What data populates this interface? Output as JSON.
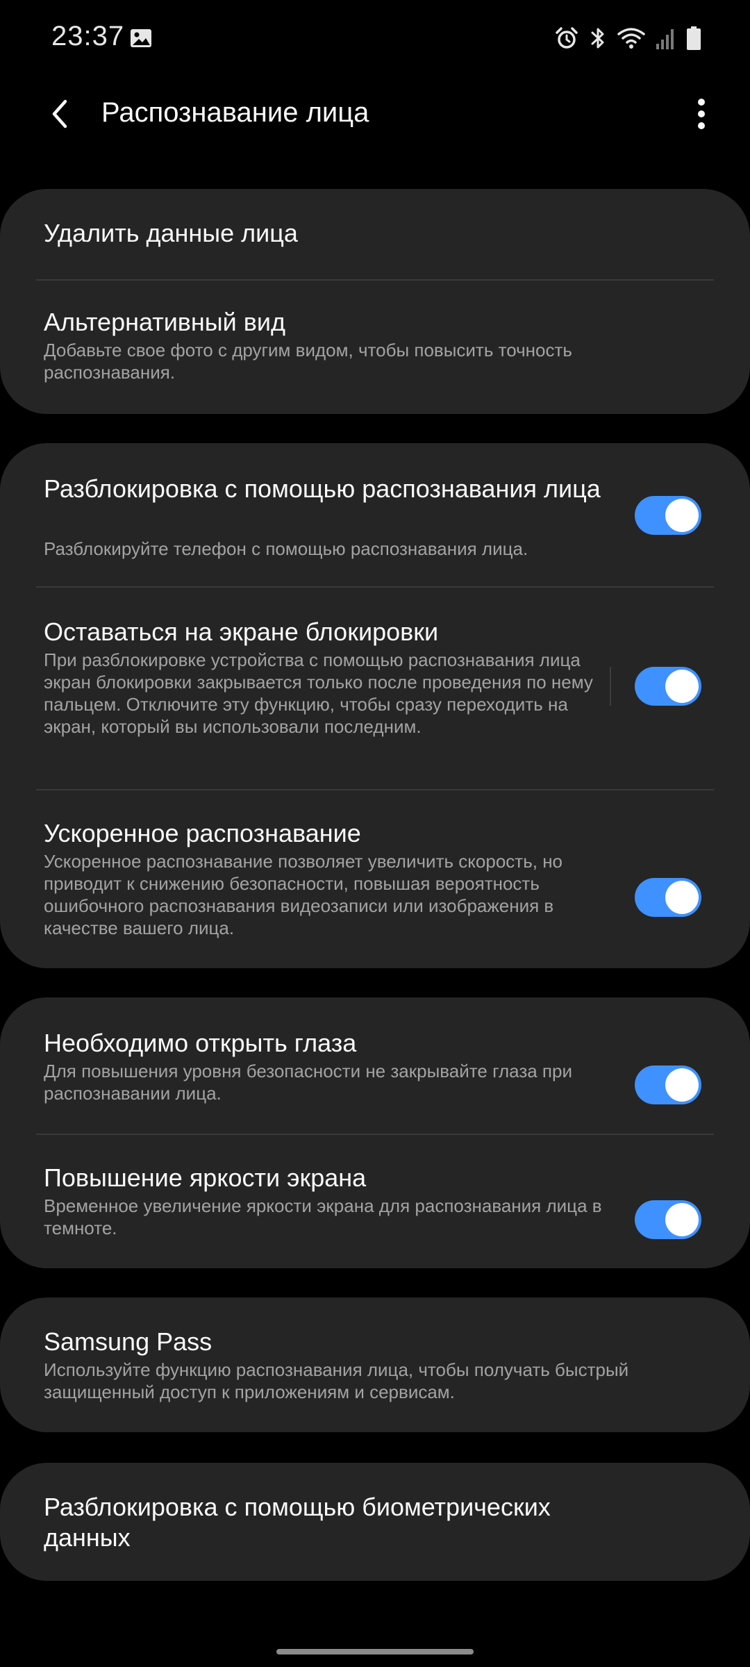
{
  "status_bar": {
    "time": "23:37",
    "left_icons": [
      "gallery-icon"
    ],
    "right_icons": [
      "alarm-icon",
      "bluetooth-icon",
      "wifi-icon",
      "signal-icon",
      "battery-icon"
    ]
  },
  "header": {
    "title": "Распознавание лица",
    "back_icon": "back-arrow-icon",
    "more_icon": "more-vert-icon"
  },
  "groups": [
    {
      "items": [
        {
          "title": "Удалить данные лица"
        },
        {
          "title": "Альтернативный вид",
          "subtitle": "Добавьте свое фото с другим видом, чтобы повысить точность распознавания."
        }
      ]
    },
    {
      "items": [
        {
          "title": "Разблокировка с помощью распознавания лица",
          "subtitle": "Разблокируйте телефон с помощью распознавания лица.",
          "toggle": true
        },
        {
          "title": "Оставаться на экране блокировки",
          "subtitle": "При разблокировке устройства с помощью распознавания лица экран блокировки закрывается только после проведения по нему пальцем. Отключите эту функцию, чтобы сразу переходить на экран, который вы использовали последним.",
          "toggle": true
        },
        {
          "title": "Ускоренное распознавание",
          "subtitle": "Ускоренное распознавание позволяет увеличить скорость, но приводит к снижению безопасности, повышая вероятность ошибочного распознавания видеозаписи или изображения в качестве вашего лица.",
          "toggle": true
        }
      ]
    },
    {
      "items": [
        {
          "title": "Необходимо открыть глаза",
          "subtitle": "Для повышения уровня безопасности не закрывайте глаза при распознавании лица.",
          "toggle": true
        },
        {
          "title": "Повышение яркости экрана",
          "subtitle": "Временное увеличение яркости экрана для распознавания лица в темноте.",
          "toggle": true
        }
      ]
    },
    {
      "items": [
        {
          "title": "Samsung Pass",
          "subtitle": "Используйте функцию распознавания лица, чтобы получать быстрый защищенный доступ к приложениям и сервисам."
        }
      ]
    },
    {
      "items": [
        {
          "title": "Разблокировка с помощью биометрических данных"
        }
      ]
    }
  ],
  "colors": {
    "background": "#000000",
    "card": "#252525",
    "accent_toggle": "#3E91FF",
    "title_text": "#FAFAFA",
    "subtitle_text": "#A3A3A3"
  }
}
